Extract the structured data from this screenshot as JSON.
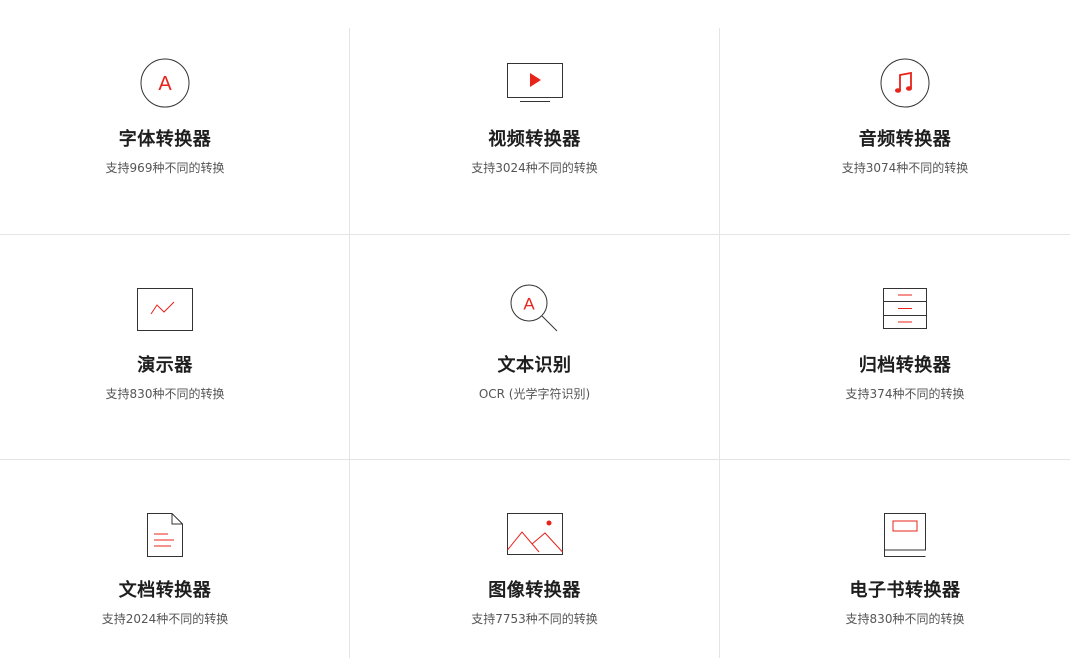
{
  "converters": [
    {
      "id": "font",
      "icon": "font-icon",
      "title": "字体转换器",
      "subtitle": "支持969种不同的转换"
    },
    {
      "id": "video",
      "icon": "video-player-icon",
      "title": "视频转换器",
      "subtitle": "支持3024种不同的转换"
    },
    {
      "id": "audio",
      "icon": "music-note-icon",
      "title": "音频转换器",
      "subtitle": "支持3074种不同的转换"
    },
    {
      "id": "presentation",
      "icon": "presentation-chart-icon",
      "title": "演示器",
      "subtitle": "支持830种不同的转换"
    },
    {
      "id": "ocr",
      "icon": "magnifier-text-icon",
      "title": "文本识别",
      "subtitle": "OCR (光学字符识别)"
    },
    {
      "id": "archive",
      "icon": "archive-drawer-icon",
      "title": "归档转换器",
      "subtitle": "支持374种不同的转换"
    },
    {
      "id": "document",
      "icon": "document-icon",
      "title": "文档转换器",
      "subtitle": "支持2024种不同的转换"
    },
    {
      "id": "image",
      "icon": "image-mountain-icon",
      "title": "图像转换器",
      "subtitle": "支持7753种不同的转换"
    },
    {
      "id": "ebook",
      "icon": "book-icon",
      "title": "电子书转换器",
      "subtitle": "支持830种不同的转换"
    }
  ],
  "colors": {
    "accent": "#e8231a",
    "icon_stroke": "#333333",
    "divider": "#e4e4e4"
  }
}
